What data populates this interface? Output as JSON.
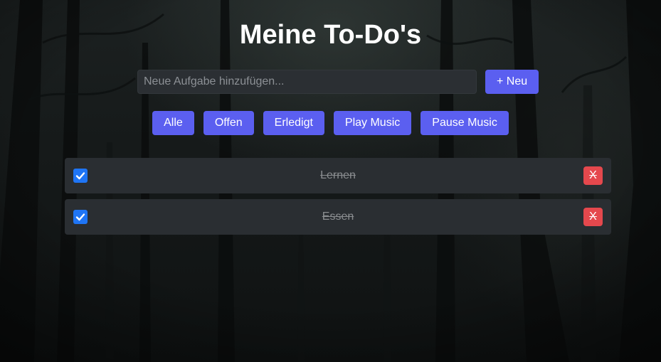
{
  "app": {
    "title": "Meine To-Do's"
  },
  "add_form": {
    "placeholder": "Neue Aufgabe hinzufügen...",
    "value": "",
    "add_label": "+ Neu"
  },
  "filters": [
    {
      "label": "Alle"
    },
    {
      "label": "Offen"
    },
    {
      "label": "Erledigt"
    },
    {
      "label": "Play Music"
    },
    {
      "label": "Pause Music"
    }
  ],
  "todos": [
    {
      "text": "Lernen",
      "done": true,
      "delete_label": "X"
    },
    {
      "text": "Essen",
      "done": true,
      "delete_label": "X"
    }
  ],
  "colors": {
    "accent": "#5b5ff0",
    "delete": "#e5484d",
    "checkbox": "#1f75f5",
    "card": "#2a2e32"
  },
  "icons": {
    "checkbox": "check-icon"
  }
}
